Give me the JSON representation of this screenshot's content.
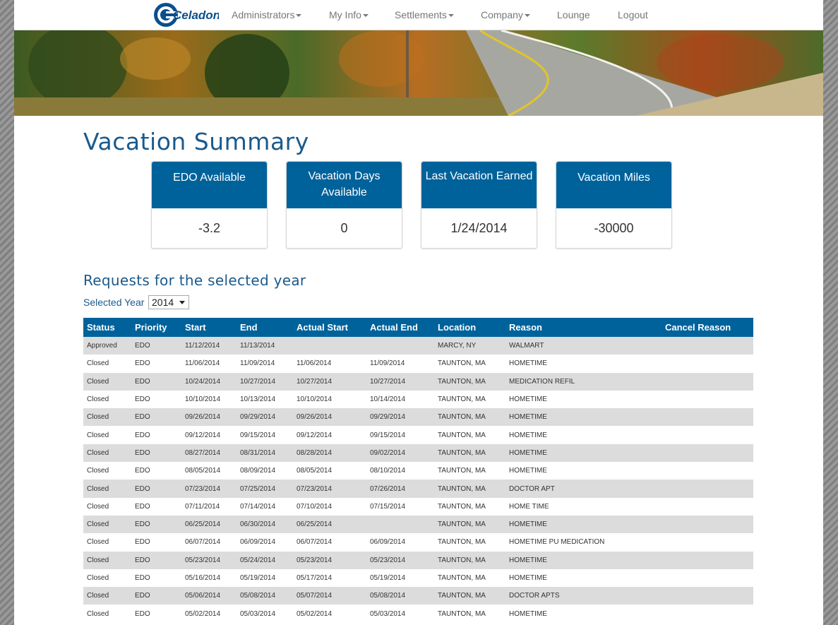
{
  "brand": {
    "logo_text": "Celadon",
    "colors": {
      "primary": "#00629b",
      "title": "#1b5a8c"
    }
  },
  "nav": {
    "items": [
      {
        "label": "Administrators",
        "dropdown": true
      },
      {
        "label": "My Info",
        "dropdown": true
      },
      {
        "label": "Settlements",
        "dropdown": true
      },
      {
        "label": "Company",
        "dropdown": true
      },
      {
        "label": "Lounge",
        "dropdown": false
      },
      {
        "label": "Logout",
        "dropdown": false
      }
    ]
  },
  "page": {
    "title": "Vacation Summary"
  },
  "cards": [
    {
      "label": "EDO Available",
      "value": "-3.2"
    },
    {
      "label": "Vacation Days Available",
      "value": "0"
    },
    {
      "label": "Last Vacation Earned",
      "value": "1/24/2014"
    },
    {
      "label": "Vacation Miles",
      "value": "-30000"
    }
  ],
  "requests": {
    "title": "Requests for the selected year",
    "year_label": "Selected Year",
    "selected_year": "2014",
    "columns": [
      "Status",
      "Priority",
      "Start",
      "End",
      "Actual Start",
      "Actual End",
      "Location",
      "Reason",
      "Cancel Reason"
    ],
    "rows": [
      [
        "Approved",
        "EDO",
        "11/12/2014",
        "11/13/2014",
        "",
        "",
        "MARCY, NY",
        "WALMART",
        ""
      ],
      [
        "Closed",
        "EDO",
        "11/06/2014",
        "11/09/2014",
        "11/06/2014",
        "11/09/2014",
        "TAUNTON, MA",
        "HOMETIME",
        ""
      ],
      [
        "Closed",
        "EDO",
        "10/24/2014",
        "10/27/2014",
        "10/27/2014",
        "10/27/2014",
        "TAUNTON, MA",
        "MEDICATION REFIL",
        ""
      ],
      [
        "Closed",
        "EDO",
        "10/10/2014",
        "10/13/2014",
        "10/10/2014",
        "10/14/2014",
        "TAUNTON, MA",
        "HOMETIME",
        ""
      ],
      [
        "Closed",
        "EDO",
        "09/26/2014",
        "09/29/2014",
        "09/26/2014",
        "09/29/2014",
        "TAUNTON, MA",
        "HOMETIME",
        ""
      ],
      [
        "Closed",
        "EDO",
        "09/12/2014",
        "09/15/2014",
        "09/12/2014",
        "09/15/2014",
        "TAUNTON, MA",
        "HOMETIME",
        ""
      ],
      [
        "Closed",
        "EDO",
        "08/27/2014",
        "08/31/2014",
        "08/28/2014",
        "09/02/2014",
        "TAUNTON, MA",
        "HOMETIME",
        ""
      ],
      [
        "Closed",
        "EDO",
        "08/05/2014",
        "08/09/2014",
        "08/05/2014",
        "08/10/2014",
        "TAUNTON, MA",
        "HOMETIME",
        ""
      ],
      [
        "Closed",
        "EDO",
        "07/23/2014",
        "07/25/2014",
        "07/23/2014",
        "07/26/2014",
        "TAUNTON, MA",
        "DOCTOR APT",
        ""
      ],
      [
        "Closed",
        "EDO",
        "07/11/2014",
        "07/14/2014",
        "07/10/2014",
        "07/15/2014",
        "TAUNTON, MA",
        "HOME TIME",
        ""
      ],
      [
        "Closed",
        "EDO",
        "06/25/2014",
        "06/30/2014",
        "06/25/2014",
        "",
        "TAUNTON, MA",
        "HOMETIME",
        ""
      ],
      [
        "Closed",
        "EDO",
        "06/07/2014",
        "06/09/2014",
        "06/07/2014",
        "06/09/2014",
        "TAUNTON, MA",
        "HOMETIME PU MEDICATION",
        ""
      ],
      [
        "Closed",
        "EDO",
        "05/23/2014",
        "05/24/2014",
        "05/23/2014",
        "05/23/2014",
        "TAUNTON, MA",
        "HOMETIME",
        ""
      ],
      [
        "Closed",
        "EDO",
        "05/16/2014",
        "05/19/2014",
        "05/17/2014",
        "05/19/2014",
        "TAUNTON, MA",
        "HOMETIME",
        ""
      ],
      [
        "Closed",
        "EDO",
        "05/06/2014",
        "05/08/2014",
        "05/07/2014",
        "05/08/2014",
        "TAUNTON, MA",
        "DOCTOR APTS",
        ""
      ],
      [
        "Closed",
        "EDO",
        "05/02/2014",
        "05/03/2014",
        "05/02/2014",
        "05/03/2014",
        "TAUNTON, MA",
        "HOMETIME",
        ""
      ]
    ]
  }
}
